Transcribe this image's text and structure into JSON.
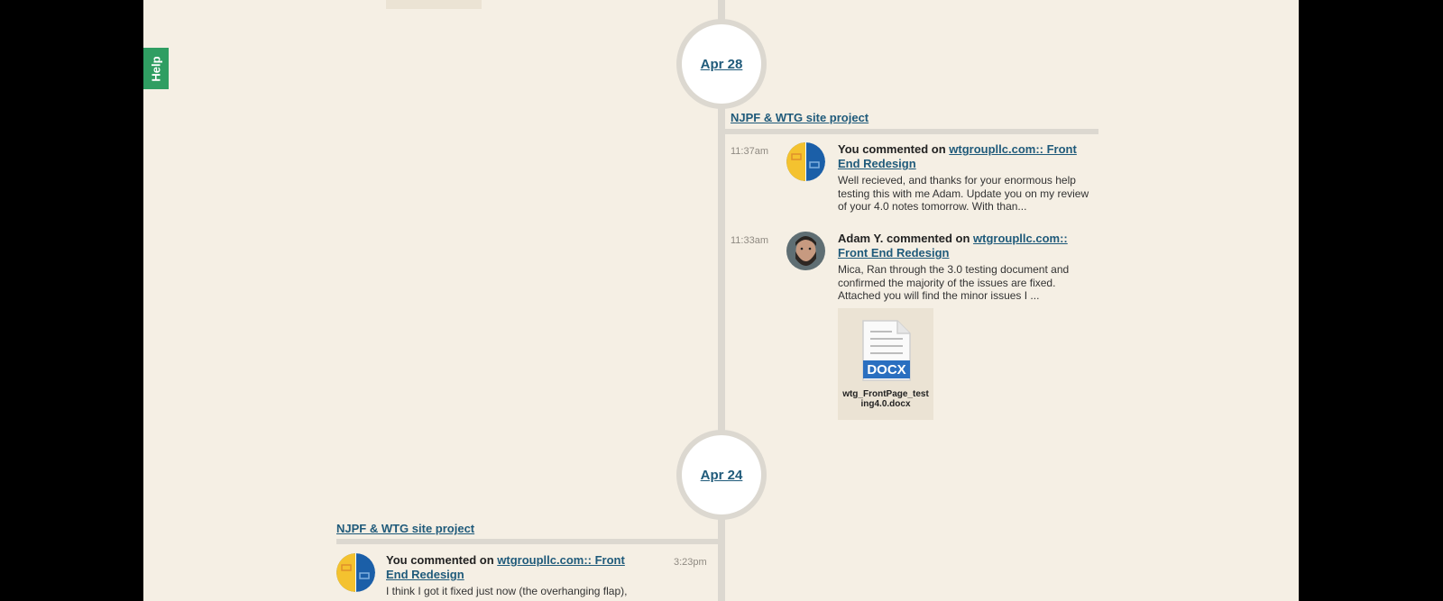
{
  "help": {
    "label": "Help"
  },
  "timeline": {
    "dates": [
      {
        "label": "Apr 28"
      },
      {
        "label": "Apr 24"
      }
    ],
    "groups": [
      {
        "project": "NJPF & WTG site project",
        "entries": [
          {
            "time": "11:37am",
            "actor": "You commented on",
            "target": "wtgroupllc.com:: Front End Redesign",
            "excerpt": "Well recieved, and thanks for your enormous help testing this with me Adam. Update you on my review of your 4.0 notes tomorrow. With than..."
          },
          {
            "time": "11:33am",
            "actor": "Adam Y. commented on",
            "target": "wtgroupllc.com:: Front End Redesign",
            "excerpt": "Mica, Ran through the 3.0 testing document and confirmed the majority of the issues are fixed. Attached you will find the minor issues I ...",
            "attachment": {
              "type": "DOCX",
              "filename": "wtg_FrontPage_testing4.0.docx"
            }
          }
        ]
      },
      {
        "project": "NJPF & WTG site project",
        "entries": [
          {
            "time": "3:23pm",
            "actor": "You commented on",
            "target": "wtgroupllc.com:: Front End Redesign",
            "excerpt": "I think I got it fixed just now (the overhanging flap),"
          }
        ]
      }
    ]
  },
  "colors": {
    "background": "#f5efe4",
    "link": "#1f5a7a",
    "help_tab": "#2f9e62",
    "axis": "#dcd8d0"
  },
  "icons": {
    "project_avatar": "wtg-logo-icon",
    "person_avatar": "user-photo-avatar",
    "attachment": "docx-file-icon"
  }
}
